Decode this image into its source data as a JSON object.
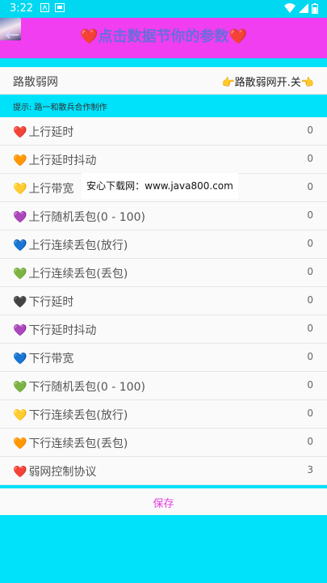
{
  "status_bar": {
    "time": "3:22",
    "icons": [
      "notification-icon",
      "image-icon",
      "wifi-icon",
      "signal-icon",
      "battery-icon"
    ]
  },
  "header": {
    "avatar_icon": "avatar-icon",
    "back_icon": "back-arrow-icon",
    "heart_left": "❤️",
    "title": "点击数据节你的参数",
    "heart_right": "❤️",
    "bg_color": "#f03ef0"
  },
  "top_row": {
    "label": "路散弱网",
    "action": "👉路散弱网开.关👈"
  },
  "hint": "提示: 路一和散兵合作制作",
  "settings": [
    {
      "icon": "❤️",
      "color": "#ee7d7d",
      "label": "上行延时",
      "value": "0"
    },
    {
      "icon": "🧡",
      "color": "#f3a54e",
      "label": "上行延时抖动",
      "value": "0"
    },
    {
      "icon": "💛",
      "color": "#f6d44c",
      "label": "上行带宽",
      "value": "0"
    },
    {
      "icon": "💜",
      "color": "#b26ad8",
      "label": "上行随机丢包(0 - 100)",
      "value": "0"
    },
    {
      "icon": "💙",
      "color": "#5aa0e6",
      "label": "上行连续丢包(放行)",
      "value": "0"
    },
    {
      "icon": "💚",
      "color": "#84c86a",
      "label": "上行连续丢包(丢包)",
      "value": "0"
    },
    {
      "icon": "🖤",
      "color": "#555555",
      "label": "下行延时",
      "value": "0"
    },
    {
      "icon": "💜",
      "color": "#b26ad8",
      "label": "下行延时抖动",
      "value": "0"
    },
    {
      "icon": "💙",
      "color": "#5aa0e6",
      "label": "下行带宽",
      "value": "0"
    },
    {
      "icon": "💚",
      "color": "#84c86a",
      "label": "下行随机丢包(0 - 100)",
      "value": "0"
    },
    {
      "icon": "💛",
      "color": "#f6d44c",
      "label": "下行连续丢包(放行)",
      "value": "0"
    },
    {
      "icon": "🧡",
      "color": "#f3a54e",
      "label": "下行连续丢包(丢包)",
      "value": "0"
    },
    {
      "icon": "❤️",
      "color": "#ee7d7d",
      "label": "弱网控制协议",
      "value": "3"
    }
  ],
  "watermark": "安心下载网：www.java800.com",
  "save_label": "保存"
}
